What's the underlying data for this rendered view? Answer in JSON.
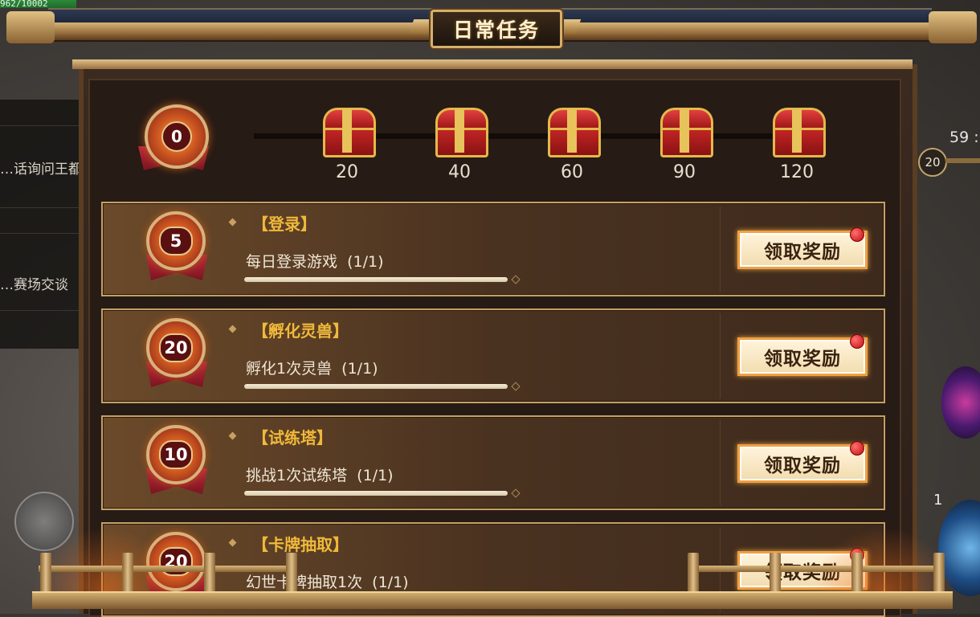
{
  "background": {
    "hp_text": "962/10002",
    "chat_lines": [
      "…话询问王都情",
      "…赛场交谈"
    ],
    "timer": "59 :",
    "level": "20",
    "skill_count": "1"
  },
  "header": {
    "title": "日常任务"
  },
  "progress": {
    "current_points": "0",
    "chests": [
      {
        "label": "20"
      },
      {
        "label": "40"
      },
      {
        "label": "60"
      },
      {
        "label": "90"
      },
      {
        "label": "120"
      }
    ]
  },
  "tasks": [
    {
      "points": "5",
      "title": "【登录】",
      "desc": "每日登录游戏  (1/1)",
      "progress": 1.0,
      "button": "领取奖励"
    },
    {
      "points": "20",
      "title": "【孵化灵兽】",
      "desc": "孵化1次灵兽  (1/1)",
      "progress": 1.0,
      "button": "领取奖励"
    },
    {
      "points": "10",
      "title": "【试练塔】",
      "desc": "挑战1次试练塔  (1/1)",
      "progress": 1.0,
      "button": "领取奖励"
    },
    {
      "points": "20",
      "title": "【卡牌抽取】",
      "desc": "幻世卡牌抽取1次  (1/1)",
      "progress": 1.0,
      "button": "领取奖励"
    }
  ],
  "colors": {
    "task_title": "#f0b93a",
    "button_border": "#f0a040",
    "notification": "#c40c0c"
  }
}
